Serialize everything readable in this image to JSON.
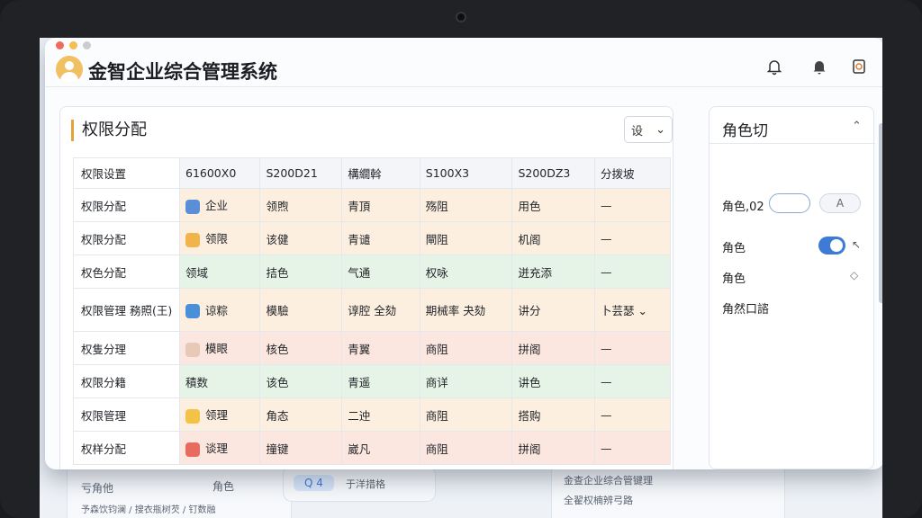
{
  "app": {
    "title": "金智企业综合管理系统"
  },
  "panel": {
    "title": "权限分配",
    "filter_label": "设"
  },
  "table": {
    "headers": [
      "权限设置",
      "61600X0",
      "S200D21",
      "構繝斡",
      "S100X3",
      "S200DZ3",
      "分拨坡"
    ],
    "rows": [
      {
        "cells": [
          "权限分配",
          "企业",
          "领煦",
          "青頂",
          "殇阻",
          "用色",
          "—"
        ],
        "color": "#fcefdf",
        "icon": "user-icon"
      },
      {
        "cells": [
          "权限分配",
          "领限",
          "该健",
          "青谴",
          "閘阻",
          "机阁",
          "—"
        ],
        "color": "#fcefdf",
        "icon": "coin-icon"
      },
      {
        "cells": [
          "权色分配",
          "领域",
          "拮色",
          "气通",
          "权咏",
          "迸充添",
          "—"
        ],
        "color": "#e6f3e7",
        "icon": ""
      },
      {
        "cells": [
          "权限管理 務照(王)",
          "谅粽",
          "模驗",
          "谆腔 全劾",
          "期械率 夬劾",
          "讲分",
          "卜芸瑟"
        ],
        "color": "#fcefdf",
        "icon": "share-icon"
      },
      {
        "cells": [
          "权隻分理",
          "模眼",
          "核色",
          "青翼",
          "商阻",
          "拼阁",
          "—"
        ],
        "color": "#fbe7df",
        "icon": "person-icon"
      },
      {
        "cells": [
          "权限分籍",
          "積数",
          "该色",
          "青遥",
          "商详",
          "讲色",
          "—"
        ],
        "color": "#e6f3e7",
        "icon": ""
      },
      {
        "cells": [
          "权限管理",
          "领理",
          "角态",
          "二迚",
          "商阻",
          "搭购",
          "—"
        ],
        "color": "#fcefdf",
        "icon": "bulb-icon"
      },
      {
        "cells": [
          "权样分配",
          "谈理",
          "撞键",
          "崴凡",
          "商阻",
          "拼阁",
          "—"
        ],
        "color": "#fbe7df",
        "icon": "calendar-icon"
      }
    ]
  },
  "sidepanel": {
    "title": "角色切",
    "field_label": "角色,02",
    "search_btn": "A",
    "item1": "角色",
    "item2": "角色",
    "item3": "角然口諮"
  },
  "background": {
    "line1": "亏角他",
    "line2": "角色",
    "line3": "予森饮钧澜 / 搜衣瓶树芡 / 钉数融",
    "search": "Q 4",
    "search_hint": "于洋措格",
    "line4": "金查企业综合管键理",
    "line5": "全翟权楠辨弓路"
  },
  "colors": {
    "accent": "#e3a33a",
    "toggle": "#3d7bd6"
  }
}
